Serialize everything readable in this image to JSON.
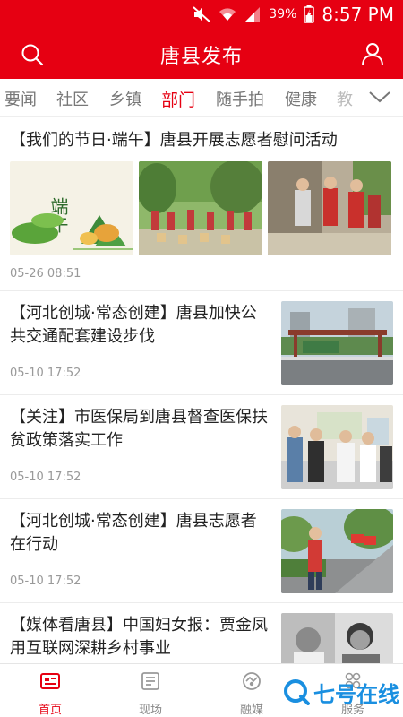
{
  "status_bar": {
    "battery": "39%",
    "time": "8:57 PM"
  },
  "header": {
    "title": "唐县发布"
  },
  "tabs": [
    {
      "label": "要闻"
    },
    {
      "label": "社区"
    },
    {
      "label": "乡镇"
    },
    {
      "label": "部门",
      "active": true
    },
    {
      "label": "随手拍"
    },
    {
      "label": "健康"
    },
    {
      "label": "教"
    }
  ],
  "feed": {
    "featured": {
      "title": "【我们的节日·端午】唐县开展志愿者慰问活动",
      "image_caption": "端午",
      "time": "05-26 08:51"
    },
    "items": [
      {
        "title": "【河北创城·常态创建】唐县加快公共交通配套建设步伐",
        "time": "05-10 17:52"
      },
      {
        "title": "【关注】市医保局到唐县督查医保扶贫政策落实工作",
        "time": "05-10 17:52"
      },
      {
        "title": "【河北创城·常态创建】唐县志愿者在行动",
        "time": "05-10 17:52"
      },
      {
        "title": "【媒体看唐县】中国妇女报：贾金凤用互联网深耕乡村事业",
        "time": ""
      }
    ]
  },
  "bottom_nav": [
    {
      "label": "首页",
      "icon": "home-icon",
      "active": true
    },
    {
      "label": "现场",
      "icon": "scene-icon"
    },
    {
      "label": "融媒",
      "icon": "media-icon"
    },
    {
      "label": "服务",
      "icon": "service-icon"
    }
  ],
  "watermark": {
    "text": "七号在线"
  },
  "colors": {
    "brand": "#e60012",
    "inactive_text": "#777777",
    "time_text": "#999999"
  }
}
